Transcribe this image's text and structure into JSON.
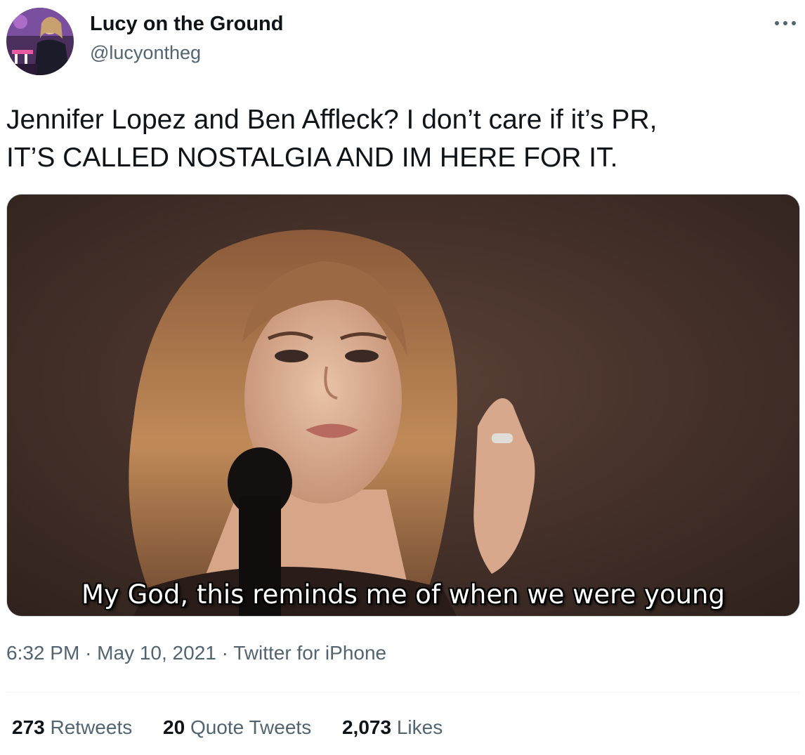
{
  "author": {
    "display_name": "Lucy on the Ground",
    "handle": "@lucyontheg"
  },
  "tweet": {
    "text_lines": [
      "Jennifer Lopez and Ben Affleck? I don’t care if it’s PR,",
      "IT’S CALLED NOSTALGIA AND IM HERE FOR IT."
    ]
  },
  "media": {
    "caption": "My God, this reminds me of when we were young"
  },
  "meta": {
    "time": "6:32 PM",
    "separator": "·",
    "date": "May 10, 2021",
    "source": "Twitter for iPhone"
  },
  "stats": {
    "retweets": {
      "count": "273",
      "label": "Retweets"
    },
    "quote_tweets": {
      "count": "20",
      "label": "Quote Tweets"
    },
    "likes": {
      "count": "2,073",
      "label": "Likes"
    }
  },
  "icons": {
    "more": "more-options-icon"
  },
  "colors": {
    "text_primary": "#0f1419",
    "text_secondary": "#536471",
    "border": "#cfd9de",
    "divider": "#eff3f4"
  }
}
